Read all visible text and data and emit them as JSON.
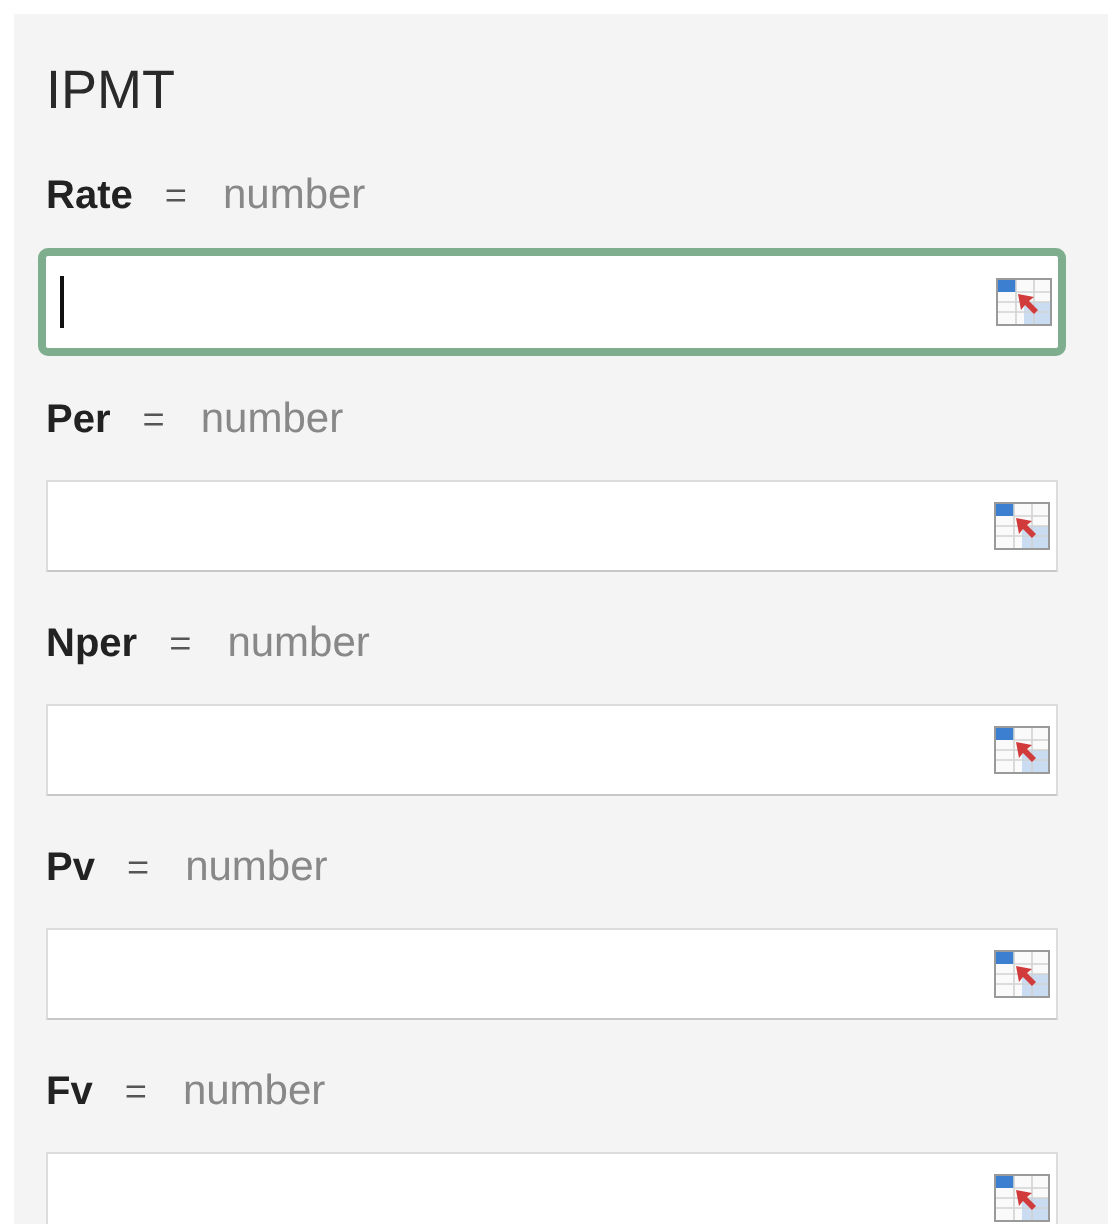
{
  "title": "IPMT",
  "arguments": [
    {
      "name": "Rate",
      "equals": "=",
      "type": "number",
      "focused": true
    },
    {
      "name": "Per",
      "equals": "=",
      "type": "number",
      "focused": false
    },
    {
      "name": "Nper",
      "equals": "=",
      "type": "number",
      "focused": false
    },
    {
      "name": "Pv",
      "equals": "=",
      "type": "number",
      "focused": false
    },
    {
      "name": "Fv",
      "equals": "=",
      "type": "number",
      "focused": false
    }
  ]
}
